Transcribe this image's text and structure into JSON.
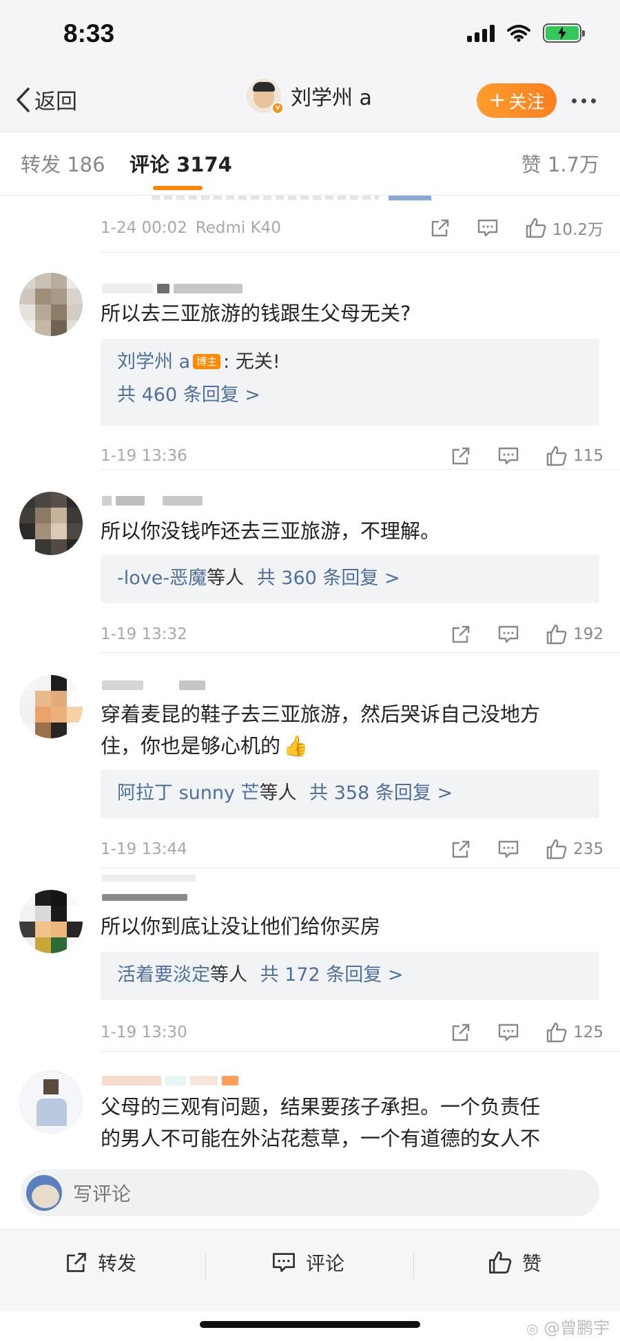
{
  "status_bar": {
    "time": "8:33"
  },
  "nav": {
    "back_label": "返回",
    "user_name": "刘学州 a",
    "follow_label": "关注"
  },
  "tabs": {
    "repost": "转发 186",
    "comments": "评论 3174",
    "likes": "赞 1.7万"
  },
  "top_meta": {
    "time": "1-24 00:02",
    "source": "Redmi K40",
    "likes": "10.2万"
  },
  "comments": [
    {
      "text": "所以去三亚旅游的钱跟生父母无关?",
      "reply_author": "刘学州 a",
      "host_tag": "博主",
      "reply_content": ": 无关!",
      "reply_count": "共 460 条回复 >",
      "time": "1-19 13:36",
      "likes": "115"
    },
    {
      "text": "所以你没钱咋还去三亚旅游，不理解。",
      "reply_author": "-love-恶魔",
      "reply_others": "等人",
      "reply_count": "共 360 条回复 >",
      "time": "1-19 13:32",
      "likes": "192"
    },
    {
      "text_line1": "穿着麦昆的鞋子去三亚旅游，然后哭诉自己没地方",
      "text_line2": "住，你也是够心机的",
      "emoji": "👍",
      "reply_author": "阿拉丁 sunny 芒",
      "reply_others": "等人",
      "reply_count": "共 358 条回复 >",
      "time": "1-19 13:44",
      "likes": "235"
    },
    {
      "text": "所以你到底让没让他们给你买房",
      "reply_author": "活着要淡定",
      "reply_others": "等人",
      "reply_count": "共 172 条回复 >",
      "time": "1-19 13:30",
      "likes": "125"
    },
    {
      "text_line1": "父母的三观有问题，结果要孩子承担。一个负责任",
      "text_line2": "的男人不可能在外沾花惹草，一个有道德的女人不"
    }
  ],
  "write_comment": {
    "placeholder": "写评论"
  },
  "bottom_bar": {
    "repost": "转发",
    "comment": "评论",
    "like": "赞"
  },
  "watermark": "@曾鹏宇",
  "colors": {
    "accent": "#ff8200",
    "link": "#4f6f9f",
    "battery": "#34c759"
  }
}
